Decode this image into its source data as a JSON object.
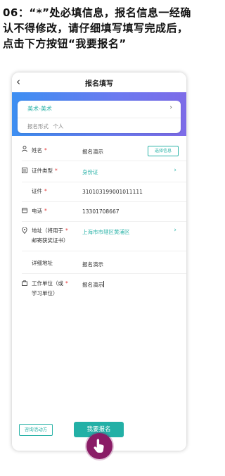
{
  "instruction": "06：“*”处必填信息，报名信息一经确认不得修改，请仔细填写填写完成后，点击下方按钮“我要报名”",
  "nav": {
    "title": "报名填写"
  },
  "activity_card": {
    "name": "美术-美术",
    "form_label": "报名形式",
    "form_value": "个人"
  },
  "fields": {
    "name": {
      "label": "姓名",
      "value": "报名演示",
      "button": "选择信息"
    },
    "id_type": {
      "label": "证件类型",
      "value": "身份证"
    },
    "id_number": {
      "label": "证件",
      "value": "310103199001011111"
    },
    "phone": {
      "label": "电话",
      "value": "13301708667"
    },
    "address": {
      "label_line1": "地址（将用于",
      "label_line2": "邮寄获奖证书）",
      "value": "上海市市辖区黄浦区"
    },
    "detail_address": {
      "label": "详细地址",
      "value": "报名演示"
    },
    "work_unit": {
      "label_line1": "工作单位（或",
      "label_line2": "学习单位）",
      "value": "报名演示"
    }
  },
  "required_mark": "*",
  "footer": {
    "consult_label": "咨询活动方",
    "register_label": "我要报名"
  },
  "colors": {
    "accent": "#2bb3a8",
    "required": "#e53b3b",
    "banner_start": "#3d8ff2",
    "banner_end": "#7d6be8",
    "tap": "#8a1c66"
  },
  "icons": [
    "back-icon",
    "person-icon",
    "id-card-icon",
    "phone-icon",
    "location-icon",
    "building-icon",
    "chevron-right-icon",
    "hand-tap-icon"
  ]
}
